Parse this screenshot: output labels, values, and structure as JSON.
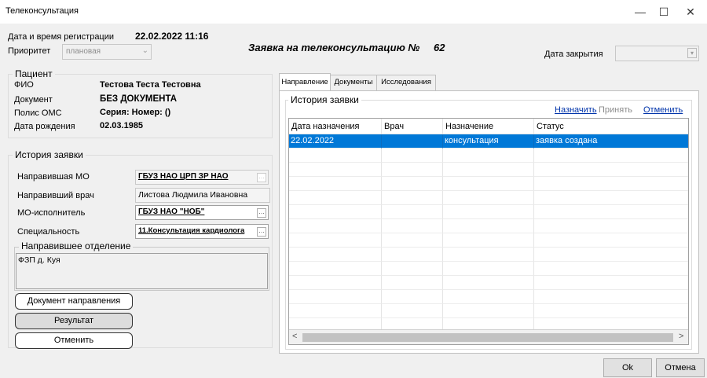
{
  "window": {
    "title": "Телеконсультация",
    "minimize": "—",
    "maximize": "☐",
    "close": "✕"
  },
  "header": {
    "reg_label": "Дата и время регистрации",
    "reg_value": "22.02.2022 11:16",
    "priority_label": "Приоритет",
    "priority_value": "плановая",
    "request_title": "Заявка на телеконсультацию №",
    "request_number": "62",
    "close_date_label": "Дата закрытия",
    "close_date_value": ""
  },
  "patient": {
    "title": "Пациент",
    "rows": [
      {
        "label": "ФИО",
        "value": "Тестова Теста Тестовна"
      },
      {
        "label": "Документ",
        "value": "БЕЗ ДОКУМЕНТА"
      },
      {
        "label": "Полис ОМС",
        "value": "Серия: Номер: ()"
      },
      {
        "label": "Дата рождения",
        "value": "02.03.1985"
      }
    ]
  },
  "history": {
    "title": "История заявки",
    "rows": [
      {
        "label": "Направившая МО",
        "value": "ГБУЗ НАО ЦРП ЗР НАО"
      },
      {
        "label": "Направивший врач",
        "value": "Листова Людмила Ивановна"
      },
      {
        "label": "МО-исполнитель",
        "value": "ГБУЗ НАО \"НОБ\""
      },
      {
        "label": "Специальность",
        "value": "11.Консультация кардиолога"
      }
    ],
    "dept_title": "Направившее отделение",
    "dept_value": "ФЗП д. Куя"
  },
  "buttons": {
    "doc": "Документ направления",
    "result": "Результат",
    "cancel": "Отменить",
    "ok": "Ok",
    "cancel_dialog": "Отмена"
  },
  "tabs": [
    "Направление",
    "Документы",
    "Исследования"
  ],
  "tab_history": {
    "title": "История заявки",
    "assign": "Назначить",
    "accept": "Принять",
    "cancel": "Отменить",
    "columns": [
      "Дата назначения",
      "Врач",
      "Назначение",
      "Статус"
    ],
    "rows": [
      [
        "22.02.2022",
        "",
        "консультация",
        "заявка создана"
      ]
    ]
  },
  "scroll": {
    "left": "<",
    "right": ">"
  }
}
